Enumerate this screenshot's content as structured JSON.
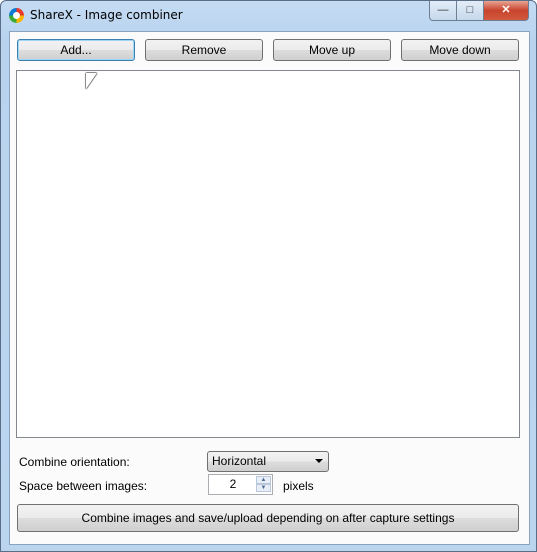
{
  "window": {
    "title": "ShareX - Image combiner",
    "minimize": "—",
    "maximize": "□",
    "close": "✕"
  },
  "toolbar": {
    "add_label": "Add...",
    "remove_label": "Remove",
    "move_up_label": "Move up",
    "move_down_label": "Move down"
  },
  "image_list": {
    "items": []
  },
  "settings": {
    "orientation_label": "Combine orientation:",
    "orientation_value": "Horizontal",
    "space_label": "Space between images:",
    "space_value": "2",
    "space_unit": "pixels",
    "spin_up": "▲",
    "spin_down": "▼"
  },
  "combine_button_label": "Combine images and save/upload depending on after capture settings"
}
